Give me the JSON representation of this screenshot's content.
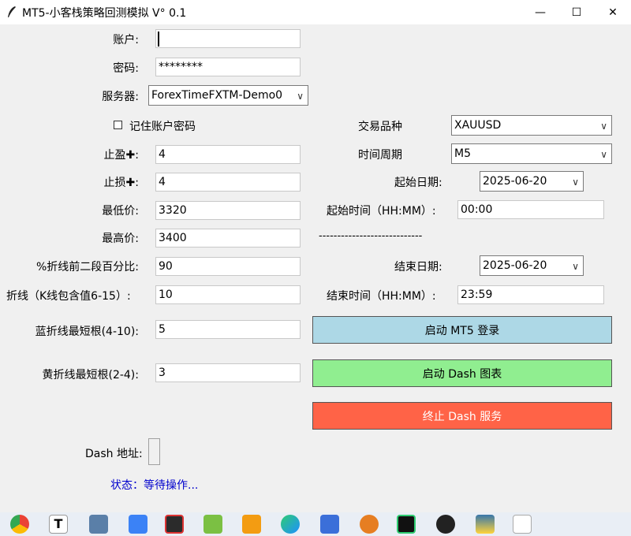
{
  "window": {
    "title": "MT5-小客栈策略回测模拟 V° 0.1",
    "minimize": "—",
    "maximize": "☐",
    "close": "✕"
  },
  "form": {
    "account_label": "账户:",
    "account_value": "",
    "password_label": "密码:",
    "password_value": "********",
    "server_label": "服务器:",
    "server_value": "ForexTimeFXTM-Demo0",
    "remember_label": "记住账户密码",
    "remember_checked": false,
    "symbol_label": "交易品种",
    "symbol_value": "XAUUSD",
    "period_label": "时间周期",
    "period_value": "M5",
    "tp_label": "止盈✚:",
    "tp_value": "4",
    "sl_label": "止损✚:",
    "sl_value": "4",
    "start_date_label": "起始日期:",
    "start_date_value": "2025-06-20",
    "min_price_label": "最低价:",
    "min_price_value": "3320",
    "start_time_label": "起始时间（HH:MM）:",
    "start_time_value": "00:00",
    "max_price_label": "最高价:",
    "max_price_value": "3400",
    "separator": "----------------------------",
    "pct_label": "%折线前二段百分比:",
    "pct_value": "90",
    "end_date_label": "结束日期:",
    "end_date_value": "2025-06-20",
    "zigzag_label": "折线（K线包含值6-15）:",
    "zigzag_value": "10",
    "end_time_label": "结束时间（HH:MM）:",
    "end_time_value": "23:59",
    "blue_label": "蓝折线最短根(4-10):",
    "blue_value": "5",
    "yellow_label": "黄折线最短根(2-4):",
    "yellow_value": "3",
    "dash_addr_label": "Dash 地址:"
  },
  "buttons": {
    "start_mt5": "启动 MT5 登录",
    "start_dash": "启动 Dash 图表",
    "stop_dash": "终止 Dash 服务"
  },
  "status": "状态：等待操作...",
  "colors": {
    "start_mt5_bg": "#add8e6",
    "start_dash_bg": "#90ee90",
    "stop_dash_bg": "#ff6347",
    "status_text": "#0000cd"
  },
  "taskbar_icons": [
    "chrome-icon",
    "typora-icon",
    "calculator-icon",
    "feishu-icon",
    "recorder-icon",
    "cube-icon",
    "vmware-icon",
    "edge-icon",
    "rustdesk-icon",
    "search-tool-icon",
    "pycharm-icon",
    "qq-icon",
    "python-idle-icon",
    "file-icon"
  ]
}
